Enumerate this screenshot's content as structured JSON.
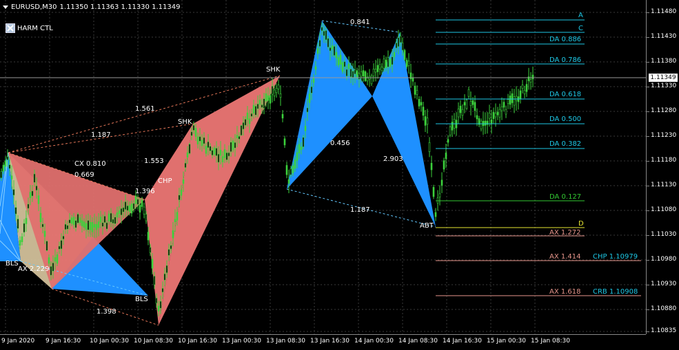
{
  "header": {
    "symbol": "EURUSD,M30",
    "ohlc": "1.11350 1.11363 1.11330 1.11349"
  },
  "indicator": {
    "label": "HARM CTL"
  },
  "price_axis": {
    "ticks": [
      "1.11480",
      "1.11430",
      "1.11380",
      "1.11330",
      "1.11280",
      "1.11230",
      "1.11180",
      "1.11130",
      "1.11080",
      "1.11030",
      "1.10980",
      "1.10930",
      "1.10880",
      "1.10835"
    ],
    "current_price": "1.11349"
  },
  "time_axis": {
    "ticks": [
      "9 Jan 2020",
      "9 Jan 16:30",
      "10 Jan 00:30",
      "10 Jan 08:30",
      "10 Jan 16:30",
      "13 Jan 00:30",
      "13 Jan 08:30",
      "13 Jan 16:30",
      "14 Jan 00:30",
      "14 Jan 08:30",
      "14 Jan 16:30",
      "15 Jan 00:30",
      "15 Jan 08:30"
    ]
  },
  "pattern_labels": {
    "shk1": "SHK",
    "shk2": "SHK",
    "chp": "CHP",
    "bls1": "BLS",
    "bls2": "BLS",
    "abt": "ABT",
    "r1561": "1.561",
    "r1187a": "1.187",
    "r1553": "1.553",
    "cx": "CX 0.810",
    "r0669": "0.669",
    "r1396": "1.396",
    "ax2229": "AX 2.229",
    "r1398": "1.398",
    "r0841": "0.841",
    "r0456": "0.456",
    "r2903": "2.903",
    "r1187b": "1.187"
  },
  "levels": {
    "a": "A",
    "c": "C",
    "da0886": "DA 0.886",
    "da0786": "DA 0.786",
    "da0618": "DA 0.618",
    "da0500": "DA 0.500",
    "da0382": "DA 0.382",
    "da0127": "DA 0.127",
    "d": "D",
    "ax1272": "AX 1.272",
    "ax1414": "AX 1.414",
    "chp10979": "CHP 1.10979",
    "ax1618": "AX 1.618",
    "crb10908": "CRB 1.10908"
  },
  "colors": {
    "bull_pattern": "#1e90ff",
    "bear_pattern": "#e0706e",
    "tan_pattern": "#d2c09a",
    "candle": "#3cd23c",
    "level_cyan": "#1ec8e6",
    "level_green": "#32c832",
    "level_yellow": "#e6e632",
    "level_salmon": "#e8968c",
    "grid": "#3a3a3a"
  }
}
